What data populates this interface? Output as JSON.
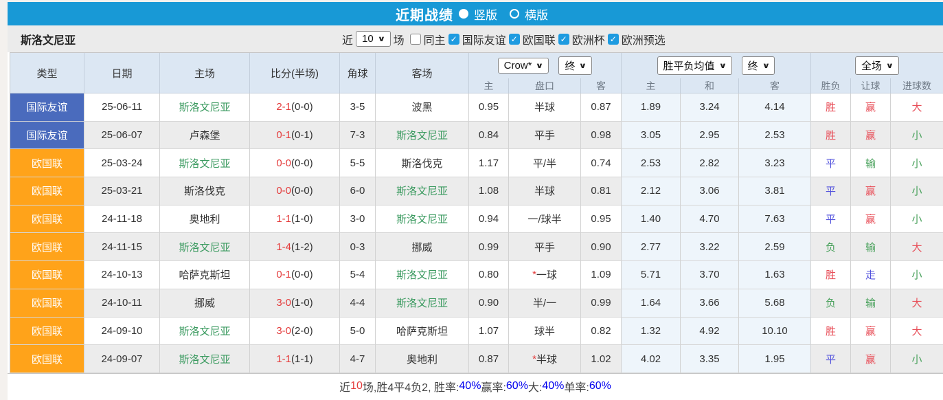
{
  "colors": {
    "accent_blue": "#1899d6",
    "checkbox_blue": "#1e9be0",
    "badge_blue": "#4a6bbd",
    "badge_orange": "#ffa31a",
    "team_green": "#3a9a5f",
    "score_red": "#e43b3b",
    "win_red": "#e8505a",
    "draw_blue": "#5353dd",
    "lose_green": "#47a05a",
    "percent_blue": "#0000ee"
  },
  "topbar": {
    "title": "近期战绩",
    "layout_options": [
      {
        "label": "竖版",
        "selected": true
      },
      {
        "label": "横版",
        "selected": false
      }
    ]
  },
  "filterbar": {
    "team": "斯洛文尼亚",
    "recent_label": "近",
    "count_value": "10",
    "matches_label": "场",
    "same_home": {
      "label": "同主",
      "checked": false
    },
    "competitions": [
      {
        "label": "国际友谊",
        "checked": true
      },
      {
        "label": "欧国联",
        "checked": true
      },
      {
        "label": "欧洲杯",
        "checked": true
      },
      {
        "label": "欧洲预选",
        "checked": true
      }
    ]
  },
  "table": {
    "static_headers": [
      "类型",
      "日期",
      "主场",
      "比分(半场)",
      "角球",
      "客场"
    ],
    "group1": {
      "select1": "Crow*",
      "select2": "终",
      "cols": [
        "主",
        "盘口",
        "客"
      ]
    },
    "group2": {
      "select1": "胜平负均值",
      "select2": "终",
      "cols": [
        "主",
        "和",
        "客"
      ]
    },
    "group3": {
      "select1": "全场",
      "cols": [
        "胜负",
        "让球",
        "进球数"
      ]
    },
    "rows": [
      {
        "type": "国际友谊",
        "type_color": "blue",
        "date": "25-06-11",
        "home": "斯洛文尼亚",
        "home_hl": true,
        "score": "2-1",
        "half": "(0-0)",
        "corners": "3-5",
        "away": "波黑",
        "away_hl": false,
        "ah_home": "0.95",
        "star": "",
        "handicap": "半球",
        "ah_away": "0.87",
        "avg_home": "1.89",
        "avg_draw": "3.24",
        "avg_away": "4.14",
        "wdl": {
          "t": "胜",
          "c": "red"
        },
        "hcp": {
          "t": "赢",
          "c": "red"
        },
        "goals": {
          "t": "大",
          "c": "red"
        }
      },
      {
        "type": "国际友谊",
        "type_color": "blue",
        "date": "25-06-07",
        "home": "卢森堡",
        "home_hl": false,
        "score": "0-1",
        "half": "(0-1)",
        "corners": "7-3",
        "away": "斯洛文尼亚",
        "away_hl": true,
        "ah_home": "0.84",
        "star": "",
        "handicap": "平手",
        "ah_away": "0.98",
        "avg_home": "3.05",
        "avg_draw": "2.95",
        "avg_away": "2.53",
        "wdl": {
          "t": "胜",
          "c": "red"
        },
        "hcp": {
          "t": "赢",
          "c": "red"
        },
        "goals": {
          "t": "小",
          "c": "green"
        }
      },
      {
        "type": "欧国联",
        "type_color": "orange",
        "date": "25-03-24",
        "home": "斯洛文尼亚",
        "home_hl": true,
        "score": "0-0",
        "half": "(0-0)",
        "corners": "5-5",
        "away": "斯洛伐克",
        "away_hl": false,
        "ah_home": "1.17",
        "star": "",
        "handicap": "平/半",
        "ah_away": "0.74",
        "avg_home": "2.53",
        "avg_draw": "2.82",
        "avg_away": "3.23",
        "wdl": {
          "t": "平",
          "c": "blue"
        },
        "hcp": {
          "t": "输",
          "c": "green"
        },
        "goals": {
          "t": "小",
          "c": "green"
        }
      },
      {
        "type": "欧国联",
        "type_color": "orange",
        "date": "25-03-21",
        "home": "斯洛伐克",
        "home_hl": false,
        "score": "0-0",
        "half": "(0-0)",
        "corners": "6-0",
        "away": "斯洛文尼亚",
        "away_hl": true,
        "ah_home": "1.08",
        "star": "",
        "handicap": "半球",
        "ah_away": "0.81",
        "avg_home": "2.12",
        "avg_draw": "3.06",
        "avg_away": "3.81",
        "wdl": {
          "t": "平",
          "c": "blue"
        },
        "hcp": {
          "t": "赢",
          "c": "red"
        },
        "goals": {
          "t": "小",
          "c": "green"
        }
      },
      {
        "type": "欧国联",
        "type_color": "orange",
        "date": "24-11-18",
        "home": "奥地利",
        "home_hl": false,
        "score": "1-1",
        "half": "(1-0)",
        "corners": "3-0",
        "away": "斯洛文尼亚",
        "away_hl": true,
        "ah_home": "0.94",
        "star": "",
        "handicap": "一/球半",
        "ah_away": "0.95",
        "avg_home": "1.40",
        "avg_draw": "4.70",
        "avg_away": "7.63",
        "wdl": {
          "t": "平",
          "c": "blue"
        },
        "hcp": {
          "t": "赢",
          "c": "red"
        },
        "goals": {
          "t": "小",
          "c": "green"
        }
      },
      {
        "type": "欧国联",
        "type_color": "orange",
        "date": "24-11-15",
        "home": "斯洛文尼亚",
        "home_hl": true,
        "score": "1-4",
        "half": "(1-2)",
        "corners": "0-3",
        "away": "挪威",
        "away_hl": false,
        "ah_home": "0.99",
        "star": "",
        "handicap": "平手",
        "ah_away": "0.90",
        "avg_home": "2.77",
        "avg_draw": "3.22",
        "avg_away": "2.59",
        "wdl": {
          "t": "负",
          "c": "green"
        },
        "hcp": {
          "t": "输",
          "c": "green"
        },
        "goals": {
          "t": "大",
          "c": "red"
        }
      },
      {
        "type": "欧国联",
        "type_color": "orange",
        "date": "24-10-13",
        "home": "哈萨克斯坦",
        "home_hl": false,
        "score": "0-1",
        "half": "(0-0)",
        "corners": "5-4",
        "away": "斯洛文尼亚",
        "away_hl": true,
        "ah_home": "0.80",
        "star": "*",
        "handicap": "一球",
        "ah_away": "1.09",
        "avg_home": "5.71",
        "avg_draw": "3.70",
        "avg_away": "1.63",
        "wdl": {
          "t": "胜",
          "c": "red"
        },
        "hcp": {
          "t": "走",
          "c": "blue"
        },
        "goals": {
          "t": "小",
          "c": "green"
        }
      },
      {
        "type": "欧国联",
        "type_color": "orange",
        "date": "24-10-11",
        "home": "挪威",
        "home_hl": false,
        "score": "3-0",
        "half": "(1-0)",
        "corners": "4-4",
        "away": "斯洛文尼亚",
        "away_hl": true,
        "ah_home": "0.90",
        "star": "",
        "handicap": "半/一",
        "ah_away": "0.99",
        "avg_home": "1.64",
        "avg_draw": "3.66",
        "avg_away": "5.68",
        "wdl": {
          "t": "负",
          "c": "green"
        },
        "hcp": {
          "t": "输",
          "c": "green"
        },
        "goals": {
          "t": "大",
          "c": "red"
        }
      },
      {
        "type": "欧国联",
        "type_color": "orange",
        "date": "24-09-10",
        "home": "斯洛文尼亚",
        "home_hl": true,
        "score": "3-0",
        "half": "(2-0)",
        "corners": "5-0",
        "away": "哈萨克斯坦",
        "away_hl": false,
        "ah_home": "1.07",
        "star": "",
        "handicap": "球半",
        "ah_away": "0.82",
        "avg_home": "1.32",
        "avg_draw": "4.92",
        "avg_away": "10.10",
        "wdl": {
          "t": "胜",
          "c": "red"
        },
        "hcp": {
          "t": "赢",
          "c": "red"
        },
        "goals": {
          "t": "大",
          "c": "red"
        }
      },
      {
        "type": "欧国联",
        "type_color": "orange",
        "date": "24-09-07",
        "home": "斯洛文尼亚",
        "home_hl": true,
        "score": "1-1",
        "half": "(1-1)",
        "corners": "4-7",
        "away": "奥地利",
        "away_hl": false,
        "ah_home": "0.87",
        "star": "*",
        "handicap": "半球",
        "ah_away": "1.02",
        "avg_home": "4.02",
        "avg_draw": "3.35",
        "avg_away": "1.95",
        "wdl": {
          "t": "平",
          "c": "blue"
        },
        "hcp": {
          "t": "赢",
          "c": "red"
        },
        "goals": {
          "t": "小",
          "c": "green"
        }
      }
    ]
  },
  "summary": {
    "segments": [
      {
        "text": "近",
        "color": "#444444"
      },
      {
        "text": "10",
        "color": "#e43b3b"
      },
      {
        "text": "场,胜4平4负2, 胜率:",
        "color": "#444444"
      },
      {
        "text": "40%",
        "color": "#0000ee"
      },
      {
        "text": " 赢率:",
        "color": "#444444"
      },
      {
        "text": "60%",
        "color": "#0000ee"
      },
      {
        "text": " 大:",
        "color": "#444444"
      },
      {
        "text": "40%",
        "color": "#0000ee"
      },
      {
        "text": " 单率:",
        "color": "#444444"
      },
      {
        "text": "60%",
        "color": "#0000ee"
      }
    ]
  }
}
